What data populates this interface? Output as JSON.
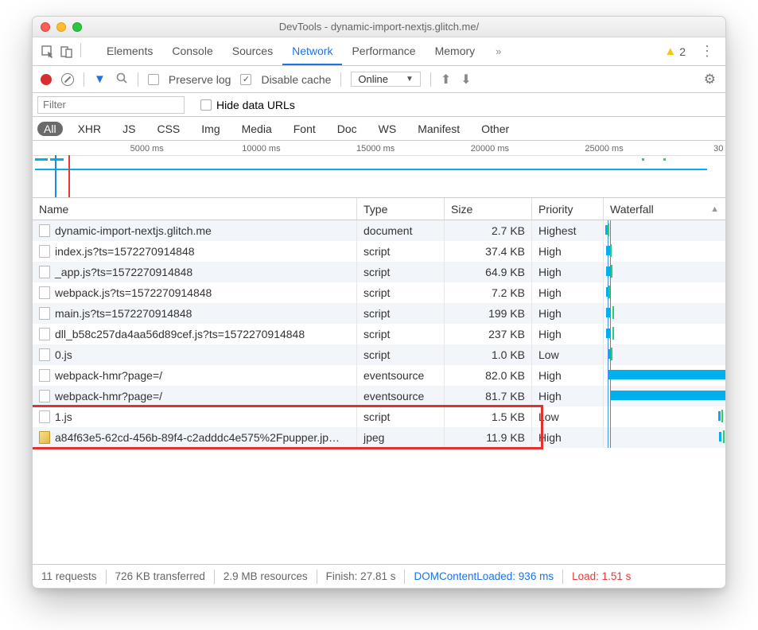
{
  "title": "DevTools - dynamic-import-nextjs.glitch.me/",
  "tabs": [
    "Elements",
    "Console",
    "Sources",
    "Network",
    "Performance",
    "Memory"
  ],
  "activeTab": "Network",
  "warningCount": "2",
  "toolbar": {
    "preserve_log": "Preserve log",
    "disable_cache": "Disable cache",
    "throttle": "Online"
  },
  "filter": {
    "placeholder": "Filter",
    "hide_data_urls": "Hide data URLs"
  },
  "typeFilters": [
    "All",
    "XHR",
    "JS",
    "CSS",
    "Img",
    "Media",
    "Font",
    "Doc",
    "WS",
    "Manifest",
    "Other"
  ],
  "activeTypeFilter": "All",
  "timeline": {
    "ticks": [
      "5000 ms",
      "10000 ms",
      "15000 ms",
      "20000 ms",
      "25000 ms",
      "30"
    ]
  },
  "columns": [
    "Name",
    "Type",
    "Size",
    "Priority",
    "Waterfall"
  ],
  "rows": [
    {
      "name": "dynamic-import-nextjs.glitch.me",
      "type": "document",
      "size": "2.7 KB",
      "priority": "Highest",
      "wf_start": 1,
      "wf_len": 2,
      "edge": 3,
      "icon": "doc"
    },
    {
      "name": "index.js?ts=1572270914848",
      "type": "script",
      "size": "37.4 KB",
      "priority": "High",
      "wf_start": 2,
      "wf_len": 3,
      "edge": 5,
      "icon": "doc"
    },
    {
      "name": "_app.js?ts=1572270914848",
      "type": "script",
      "size": "64.9 KB",
      "priority": "High",
      "wf_start": 2,
      "wf_len": 3,
      "edge": 6,
      "icon": "doc"
    },
    {
      "name": "webpack.js?ts=1572270914848",
      "type": "script",
      "size": "7.2 KB",
      "priority": "High",
      "wf_start": 2,
      "wf_len": 2,
      "edge": 4,
      "icon": "doc"
    },
    {
      "name": "main.js?ts=1572270914848",
      "type": "script",
      "size": "199 KB",
      "priority": "High",
      "wf_start": 2,
      "wf_len": 4,
      "edge": 7,
      "icon": "doc"
    },
    {
      "name": "dll_b58c257da4aa56d89cef.js?ts=1572270914848",
      "type": "script",
      "size": "237 KB",
      "priority": "High",
      "wf_start": 2,
      "wf_len": 4,
      "edge": 7,
      "icon": "doc"
    },
    {
      "name": "0.js",
      "type": "script",
      "size": "1.0 KB",
      "priority": "Low",
      "wf_start": 4,
      "wf_len": 1,
      "edge": 6,
      "icon": "doc"
    },
    {
      "name": "webpack-hmr?page=/",
      "type": "eventsource",
      "size": "82.0 KB",
      "priority": "High",
      "wf_start": 4,
      "wf_len": 96,
      "edge": 0,
      "icon": "doc"
    },
    {
      "name": "webpack-hmr?page=/",
      "type": "eventsource",
      "size": "81.7 KB",
      "priority": "High",
      "wf_start": 5,
      "wf_len": 95,
      "edge": 0,
      "icon": "doc"
    },
    {
      "name": "1.js",
      "type": "script",
      "size": "1.5 KB",
      "priority": "Low",
      "wf_start": 94,
      "wf_len": 2,
      "edge": 97,
      "icon": "doc"
    },
    {
      "name": "a84f63e5-62cd-456b-89f4-c2adddc4e575%2Fpupper.jp…",
      "type": "jpeg",
      "size": "11.9 KB",
      "priority": "High",
      "wf_start": 95,
      "wf_len": 2,
      "edge": 98,
      "icon": "img"
    }
  ],
  "status": {
    "requests": "11 requests",
    "transferred": "726 KB transferred",
    "resources": "2.9 MB resources",
    "finish": "Finish: 27.81 s",
    "dcl": "DOMContentLoaded: 936 ms",
    "load": "Load: 1.51 s"
  }
}
